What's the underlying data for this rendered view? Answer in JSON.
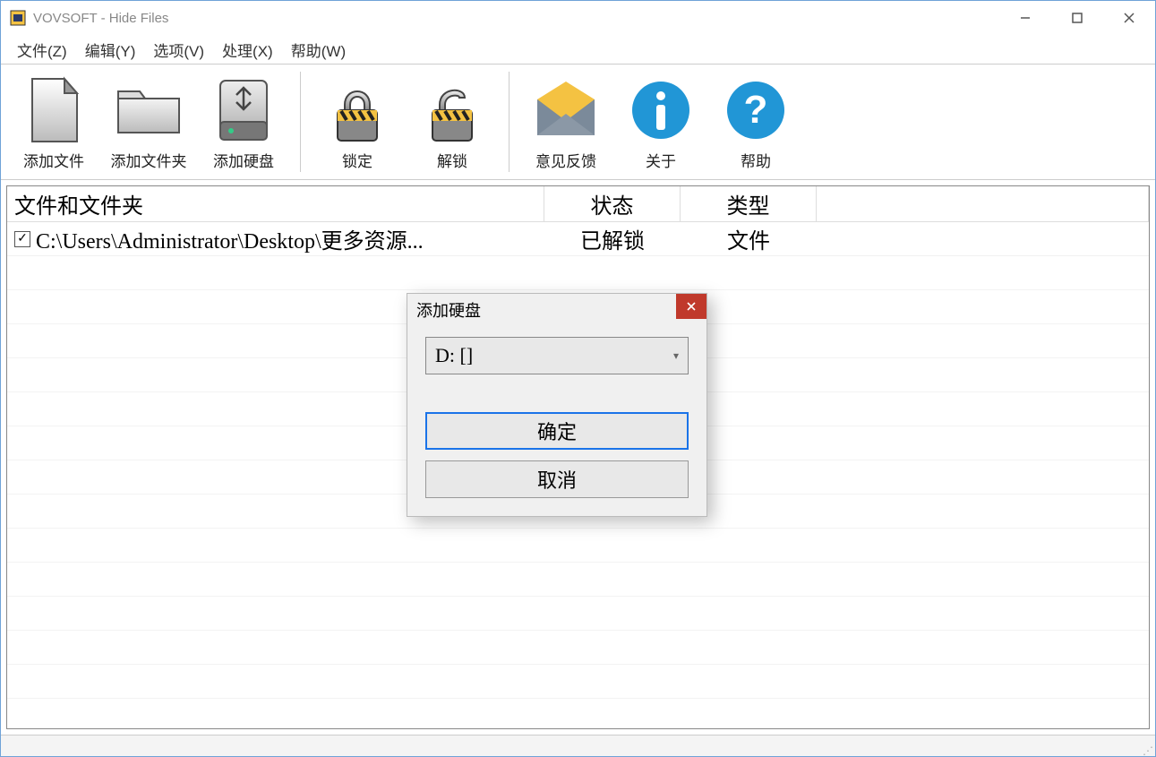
{
  "window": {
    "title": "VOVSOFT - Hide Files"
  },
  "menu": {
    "file": "文件(Z)",
    "edit": "编辑(Y)",
    "options": "选项(V)",
    "process": "处理(X)",
    "help": "帮助(W)"
  },
  "toolbar": {
    "add_file": "添加文件",
    "add_folder": "添加文件夹",
    "add_disk": "添加硬盘",
    "lock": "锁定",
    "unlock": "解锁",
    "feedback": "意见反馈",
    "about": "关于",
    "help": "帮助"
  },
  "list": {
    "headers": {
      "path": "文件和文件夹",
      "status": "状态",
      "type": "类型"
    },
    "rows": [
      {
        "checked": true,
        "path": "C:\\Users\\Administrator\\Desktop\\更多资源...",
        "status": "已解锁",
        "type": "文件"
      }
    ]
  },
  "dialog": {
    "title": "添加硬盘",
    "selected": "D: []",
    "ok": "确定",
    "cancel": "取消"
  }
}
